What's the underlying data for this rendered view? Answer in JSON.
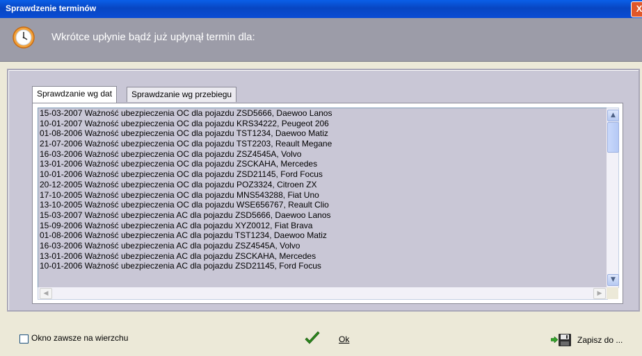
{
  "window": {
    "title": "Sprawdzenie terminów",
    "close_label": "X"
  },
  "header": {
    "message": "Wkrótce upłynie bądź już upłynął termin dla:"
  },
  "tabs": [
    {
      "label": "Sprawdzanie wg dat",
      "active": true
    },
    {
      "label": "Sprawdzanie wg przebiegu",
      "active": false
    }
  ],
  "list": {
    "items": [
      "15-03-2007 Ważność ubezpieczenia OC dla pojazdu ZSD5666, Daewoo Lanos",
      "10-01-2007 Ważność ubezpieczenia OC dla pojazdu KRS34222, Peugeot 206",
      "01-08-2006 Ważność ubezpieczenia OC dla pojazdu TST1234, Daewoo Matiz",
      "21-07-2006 Ważność ubezpieczenia OC dla pojazdu TST2203, Reault Megane",
      "16-03-2006 Ważność ubezpieczenia OC dla pojazdu ZSZ4545A, Volvo",
      "13-01-2006 Ważność ubezpieczenia OC dla pojazdu ZSCKAHA, Mercedes",
      "10-01-2006 Ważność ubezpieczenia OC dla pojazdu ZSD21145, Ford Focus",
      "20-12-2005 Ważność ubezpieczenia OC dla pojazdu POZ3324, Citroen ZX",
      "17-10-2005 Ważność ubezpieczenia OC dla pojazdu MNS543288, Fiat Uno",
      "13-10-2005 Ważność ubezpieczenia OC dla pojazdu WSE656767, Reault Clio",
      "15-03-2007 Ważność ubezpieczenia AC dla pojazdu ZSD5666, Daewoo Lanos",
      "15-09-2006 Ważność ubezpieczenia AC dla pojazdu XYZ0012, Fiat Brava",
      "01-08-2006 Ważność ubezpieczenia AC dla pojazdu TST1234, Daewoo Matiz",
      "16-03-2006 Ważność ubezpieczenia AC dla pojazdu ZSZ4545A, Volvo",
      "13-01-2006 Ważność ubezpieczenia AC dla pojazdu ZSCKAHA, Mercedes",
      "10-01-2006 Ważność ubezpieczenia AC dla pojazdu ZSD21145, Ford Focus"
    ]
  },
  "footer": {
    "always_on_top_label": "Okno zawsze na wierzchu",
    "always_on_top_checked": false,
    "ok_label": "Ok",
    "save_label": "Zapisz do ..."
  },
  "icons": {
    "header": "clock-icon",
    "ok": "checkmark-icon",
    "save_arrow": "arrow-right-icon",
    "save_disk": "floppy-disk-icon"
  },
  "colors": {
    "titlebar": "#0846c2",
    "header_bg": "#9c9ca8",
    "panel_bg": "#c9c7d6",
    "check_green": "#2c8a1c"
  }
}
